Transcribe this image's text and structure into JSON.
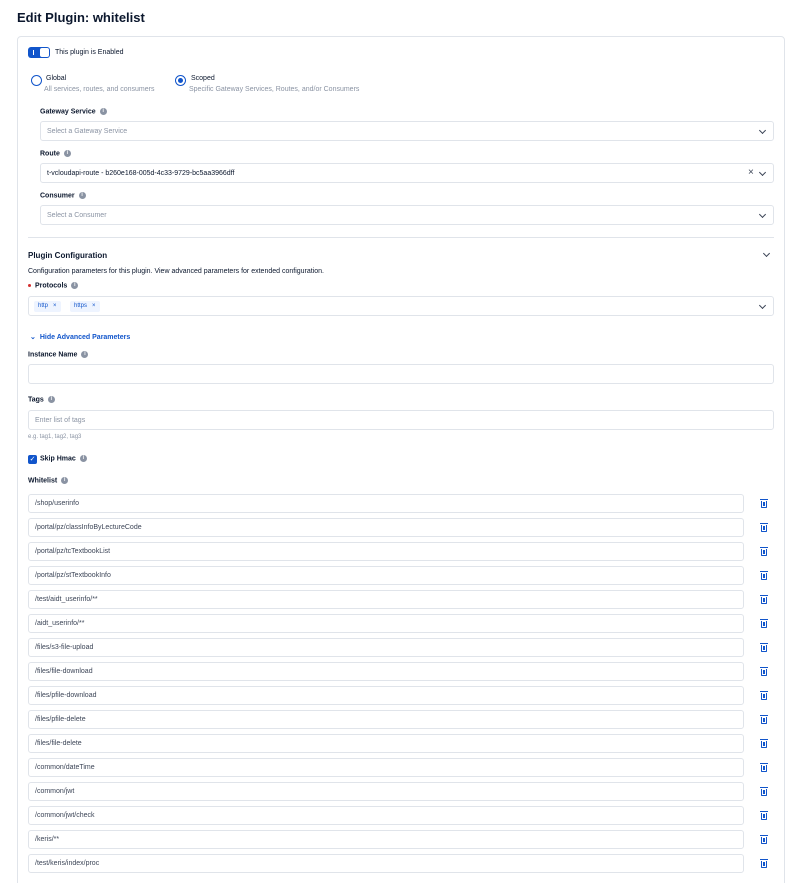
{
  "header": {
    "title": "Edit Plugin: whitelist"
  },
  "enabled": {
    "label": "This plugin is Enabled",
    "on": true
  },
  "scope": {
    "global": {
      "label": "Global",
      "desc": "All services, routes, and consumers",
      "selected": false
    },
    "scoped": {
      "label": "Scoped",
      "desc": "Specific Gateway Services, Routes, and/or Consumers",
      "selected": true
    }
  },
  "gateway_service": {
    "label": "Gateway Service",
    "placeholder": "Select a Gateway Service"
  },
  "route": {
    "label": "Route",
    "value": "t-vcloudapi-route - b260e168-005d-4c33-9729-bc5aa3966dff"
  },
  "consumer": {
    "label": "Consumer",
    "placeholder": "Select a Consumer"
  },
  "plugin_config": {
    "title": "Plugin Configuration",
    "desc": "Configuration parameters for this plugin. View advanced parameters for extended configuration."
  },
  "protocols": {
    "label": "Protocols",
    "chips": [
      "http",
      "https"
    ]
  },
  "advanced": {
    "label": "Hide Advanced Parameters"
  },
  "instance_name": {
    "label": "Instance Name",
    "value": ""
  },
  "tags": {
    "label": "Tags",
    "placeholder": "Enter list of tags",
    "hint": "e.g. tag1, tag2, tag3"
  },
  "skip_hmac": {
    "label": "Skip Hmac",
    "checked": true
  },
  "whitelist": {
    "label": "Whitelist",
    "items": [
      "/shop/userinfo",
      "/portal/pz/classInfoByLectureCode",
      "/portal/pz/tcTextbookList",
      "/portal/pz/stTextbookInfo",
      "/test/aidt_userinfo/**",
      "/aidt_userinfo/**",
      "/files/s3-file-upload",
      "/files/file-download",
      "/files/pfile-download",
      "/files/pfile-delete",
      "/files/file-delete",
      "/common/dateTime",
      "/common/jwt",
      "/common/jwt/check",
      "/keris/**",
      "/test/keris/index/proc"
    ]
  },
  "colors": {
    "accent": "#1155cb",
    "border": "#e0e4ea",
    "text": "#0b172d",
    "muted": "#8a93a3",
    "required": "#d32f2f"
  }
}
